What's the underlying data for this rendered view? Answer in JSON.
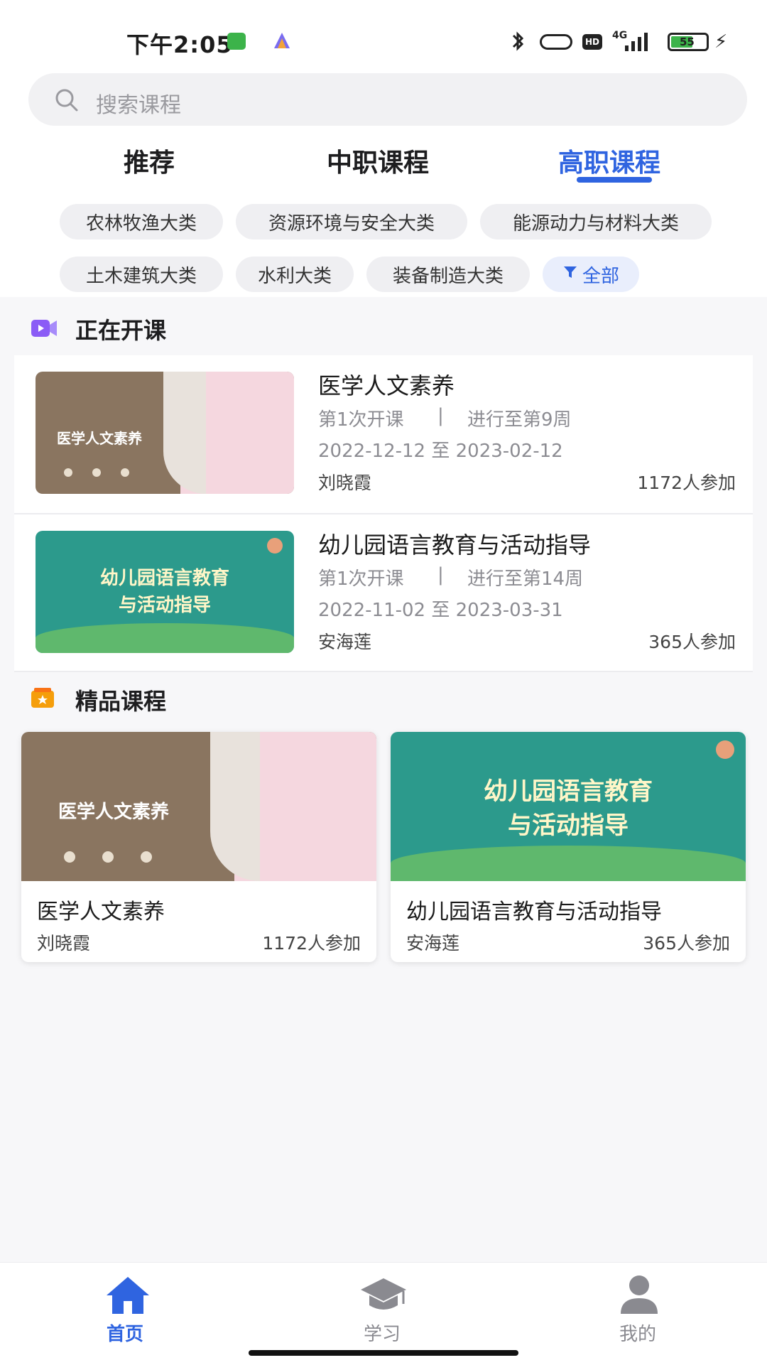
{
  "status_bar": {
    "time": "下午2:05",
    "network": "4G",
    "battery": "55"
  },
  "search": {
    "placeholder": "搜索课程"
  },
  "tabs": [
    {
      "label": "推荐",
      "active": false
    },
    {
      "label": "中职课程",
      "active": false
    },
    {
      "label": "高职课程",
      "active": true
    }
  ],
  "chips": [
    {
      "label": "农林牧渔大类"
    },
    {
      "label": "资源环境与安全大类"
    },
    {
      "label": "能源动力与材料大类"
    },
    {
      "label": "土木建筑大类"
    },
    {
      "label": "水利大类"
    },
    {
      "label": "装备制造大类"
    },
    {
      "label": "全部"
    }
  ],
  "ongoing": {
    "title": "正在开课",
    "courses": [
      {
        "title": "医学人文素养",
        "session": "第1次开课",
        "progress": "进行至第9周",
        "dates": "2022-12-12 至 2023-02-12",
        "teacher": "刘晓霞",
        "count": "1172人参加",
        "thumb_text": "医学人文素养"
      },
      {
        "title": "幼儿园语言教育与活动指导",
        "session": "第1次开课",
        "progress": "进行至第14周",
        "dates": "2022-11-02 至 2023-03-31",
        "teacher": "安海莲",
        "count": "365人参加",
        "thumb_text_line1": "幼儿园语言教育",
        "thumb_text_line2": "与活动指导"
      }
    ]
  },
  "featured": {
    "title": "精品课程",
    "cards": [
      {
        "title": "医学人文素养",
        "teacher": "刘晓霞",
        "count": "1172人参加",
        "thumb_text": "医学人文素养"
      },
      {
        "title": "幼儿园语言教育与活动指导",
        "teacher": "安海莲",
        "count": "365人参加",
        "thumb_text_line1": "幼儿园语言教育",
        "thumb_text_line2": "与活动指导"
      }
    ]
  },
  "bottom_nav": [
    {
      "label": "首页",
      "icon": "home-icon",
      "active": true
    },
    {
      "label": "学习",
      "icon": "graduation-cap-icon",
      "active": false
    },
    {
      "label": "我的",
      "icon": "user-icon",
      "active": false
    }
  ],
  "colors": {
    "accent": "#2f64e0",
    "medical_thumb": "#8a7560",
    "kinder_thumb": "#2c9a8c"
  }
}
